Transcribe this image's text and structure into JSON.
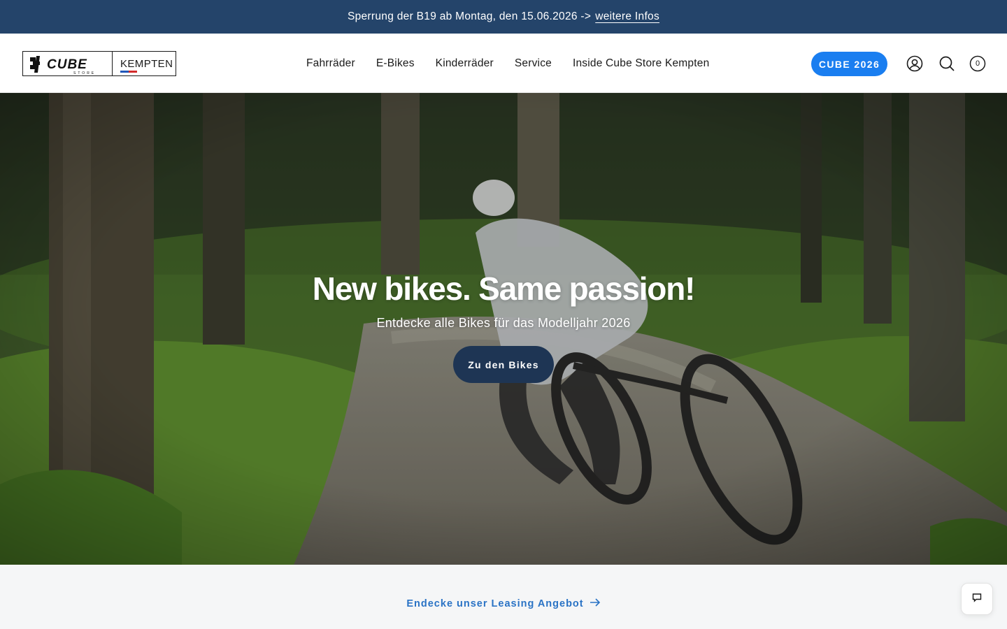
{
  "announcement": {
    "text": "Sperrung der B19 ab Montag, den 15.06.2026 ->",
    "link_label": "weitere Infos"
  },
  "header": {
    "logo": {
      "brand": "CUBE",
      "sub": "STORE",
      "location": "KEMPTEN"
    },
    "nav": [
      {
        "label": "Fahrräder"
      },
      {
        "label": "E-Bikes"
      },
      {
        "label": "Kinderräder"
      },
      {
        "label": "Service"
      },
      {
        "label": "Inside Cube Store Kempten"
      }
    ],
    "cta_label": "CUBE 2026",
    "cart_count": "0",
    "icons": [
      "account-icon",
      "search-icon",
      "cart-icon"
    ]
  },
  "hero": {
    "title": "New bikes. Same passion!",
    "subtitle": "Entdecke alle Bikes für das Modelljahr 2026",
    "button_label": "Zu den Bikes"
  },
  "leasing": {
    "link_label": "Endecke unser Leasing Angebot"
  },
  "colors": {
    "announcement_bg": "#24446a",
    "cta_blue": "#1a7ef0",
    "hero_button": "#1e3554",
    "leasing_link": "#2a73c5"
  }
}
